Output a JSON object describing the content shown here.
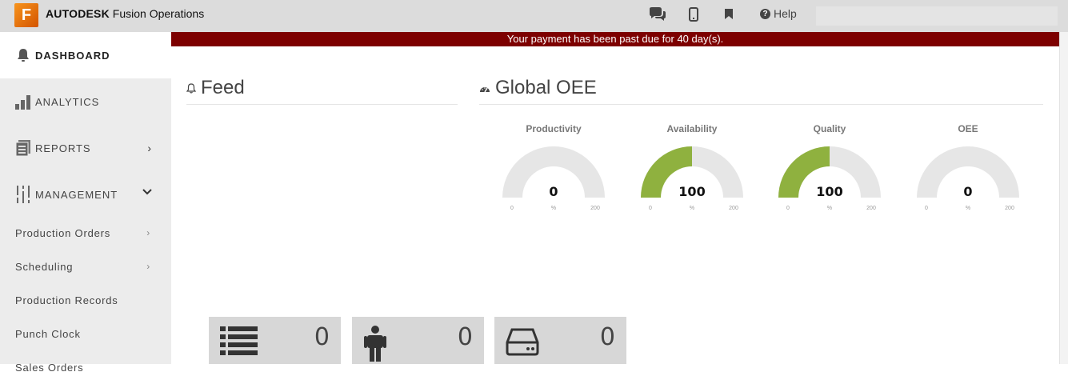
{
  "app": {
    "logo_letter": "F",
    "brand_bold": "AUTODESK",
    "brand_rest": "Fusion Operations",
    "help_label": "Help"
  },
  "banner": {
    "text": "Your payment has been past due for 40 day(s)."
  },
  "sidebar": {
    "items": [
      {
        "label": "DASHBOARD",
        "icon": "bell-icon"
      },
      {
        "label": "ANALYTICS",
        "icon": "bar-chart-icon"
      },
      {
        "label": "REPORTS",
        "icon": "report-icon",
        "chevron": "›"
      },
      {
        "label": "MANAGEMENT",
        "icon": "sliders-icon",
        "chevron": "⌄"
      }
    ],
    "subitems": [
      {
        "label": "Production Orders",
        "chevron": "›"
      },
      {
        "label": "Scheduling",
        "chevron": "›"
      },
      {
        "label": "Production Records"
      },
      {
        "label": "Punch Clock"
      },
      {
        "label": "Sales Orders"
      }
    ]
  },
  "feed": {
    "title": "Feed"
  },
  "oee": {
    "title": "Global OEE",
    "gauges": [
      {
        "label": "Productivity",
        "value": "0",
        "fraction": 0,
        "min": "0",
        "unit": "%",
        "max": "200"
      },
      {
        "label": "Availability",
        "value": "100",
        "fraction": 0.5,
        "min": "0",
        "unit": "%",
        "max": "200"
      },
      {
        "label": "Quality",
        "value": "100",
        "fraction": 0.5,
        "min": "0",
        "unit": "%",
        "max": "200"
      },
      {
        "label": "OEE",
        "value": "0",
        "fraction": 0,
        "min": "0",
        "unit": "%",
        "max": "200"
      }
    ]
  },
  "tiles": [
    {
      "icon": "list-icon",
      "value": "0"
    },
    {
      "icon": "person-icon",
      "value": "0"
    },
    {
      "icon": "hard-drive-icon",
      "value": "0"
    }
  ],
  "colors": {
    "banner": "#7d0000",
    "gauge_fill": "#8fb13f",
    "gauge_track": "#e6e6e6",
    "logo": "#f7941d"
  }
}
